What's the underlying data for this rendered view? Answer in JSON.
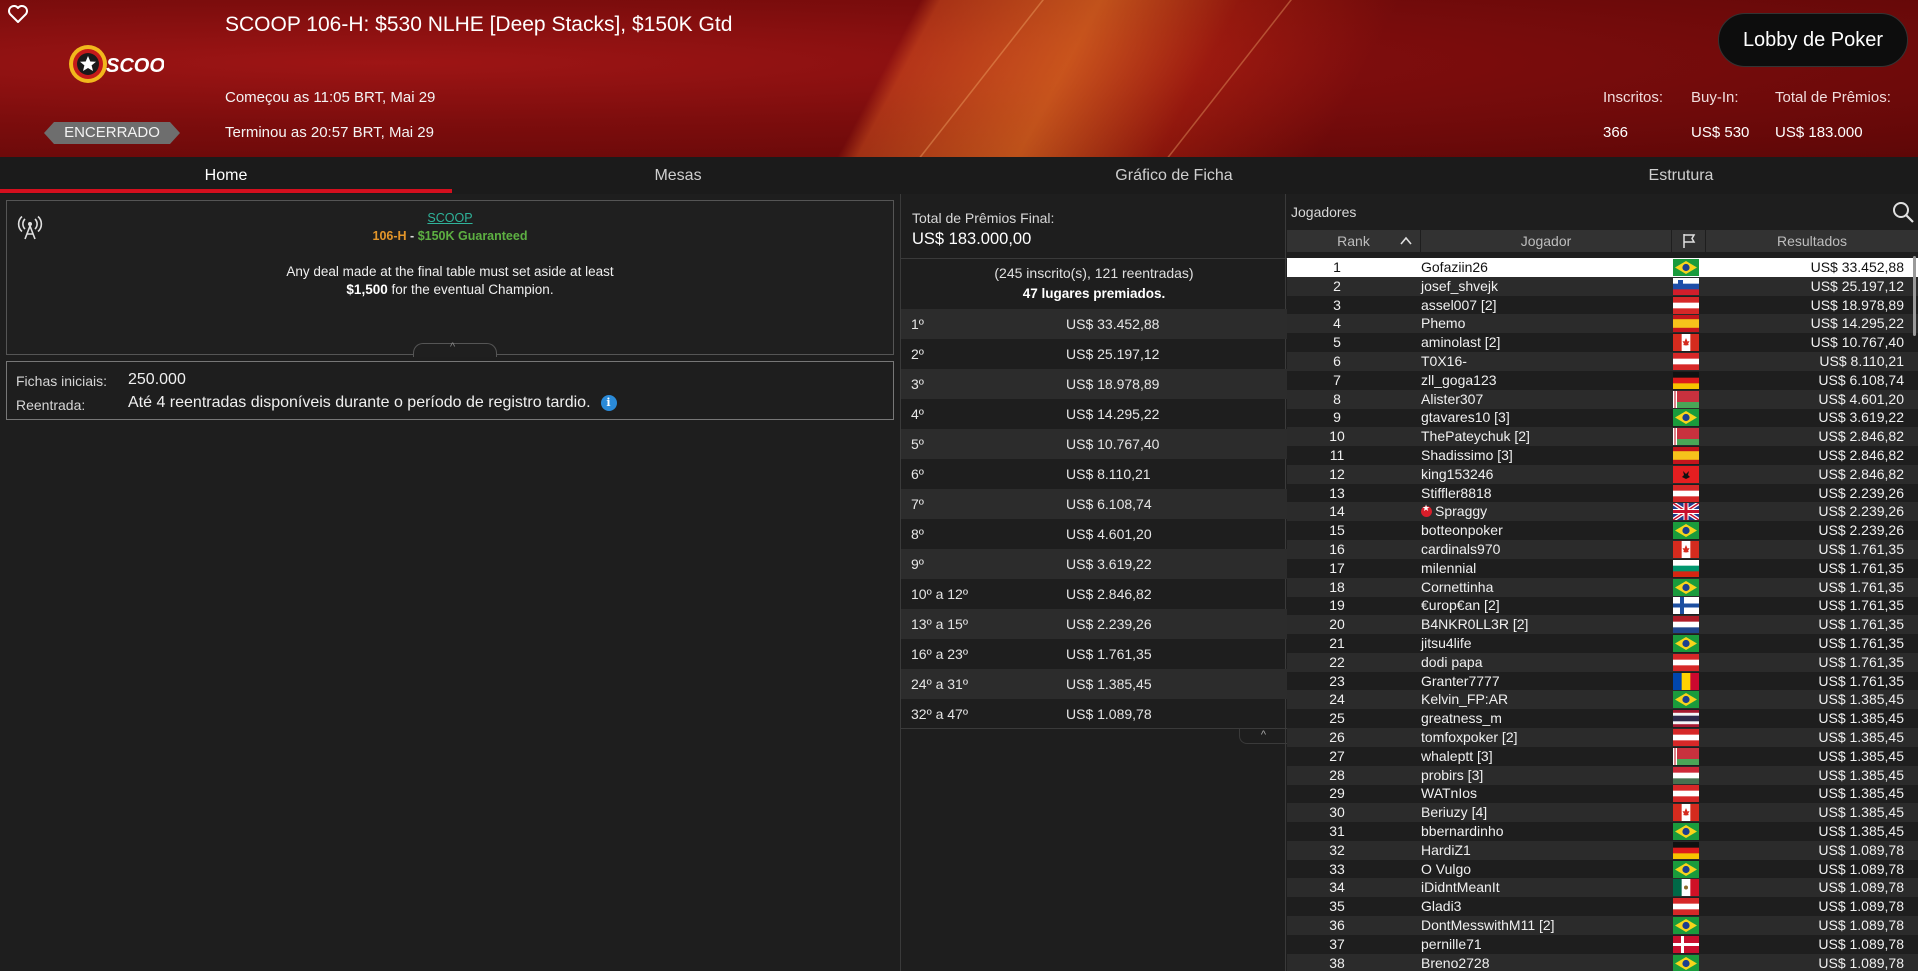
{
  "header": {
    "title": "SCOOP 106-H: $530 NLHE [Deep Stacks], $150K Gtd",
    "started": "Começou as 11:05 BRT, Mai 29",
    "ended": "Terminou as 20:57 BRT, Mai 29",
    "status": "ENCERRADO",
    "lobby_button": "Lobby de Poker",
    "logo_text": "SCOOP",
    "stats": {
      "entrants_label": "Inscritos:",
      "entrants_value": "366",
      "buyin_label": "Buy-In:",
      "buyin_value": "US$ 530",
      "prize_label": "Total de Prêmios:",
      "prize_value": "US$ 183.000"
    },
    "brand_color": "#8b0f10"
  },
  "tabs": [
    {
      "label": "Home",
      "active": true
    },
    {
      "label": "Mesas",
      "active": false
    },
    {
      "label": "Gráfico de Ficha",
      "active": false
    },
    {
      "label": "Estrutura",
      "active": false
    }
  ],
  "info": {
    "series_link": "SCOOP",
    "event_code": "106-H",
    "separator": "-",
    "guarantee": "$150K Guaranteed",
    "deal_line1": "Any deal made at the final table must set aside at least",
    "deal_amount": "$1,500",
    "deal_line2_rest": " for the eventual Champion."
  },
  "chips": {
    "start_label": "Fichas iniciais:",
    "start_value": "250.000",
    "reentry_label": "Reentrada:",
    "reentry_value": "Até 4 reentradas disponíveis durante o período de registro tardio.",
    "info_glyph": "i"
  },
  "prizes": {
    "title": "Total de Prêmios Final:",
    "total": "US$ 183.000,00",
    "entrants_line": "(245 inscrito(s), 121 reentradas)",
    "paid_line": "47 lugares premiados.",
    "rows": [
      {
        "place": "1º",
        "amount": "US$ 33.452,88"
      },
      {
        "place": "2º",
        "amount": "US$ 25.197,12"
      },
      {
        "place": "3º",
        "amount": "US$ 18.978,89"
      },
      {
        "place": "4º",
        "amount": "US$ 14.295,22"
      },
      {
        "place": "5º",
        "amount": "US$ 10.767,40"
      },
      {
        "place": "6º",
        "amount": "US$ 8.110,21"
      },
      {
        "place": "7º",
        "amount": "US$ 6.108,74"
      },
      {
        "place": "8º",
        "amount": "US$ 4.601,20"
      },
      {
        "place": "9º",
        "amount": "US$ 3.619,22"
      },
      {
        "place": "10º a 12º",
        "amount": "US$ 2.846,82"
      },
      {
        "place": "13º a 15º",
        "amount": "US$ 2.239,26"
      },
      {
        "place": "16º a 23º",
        "amount": "US$ 1.761,35"
      },
      {
        "place": "24º a 31º",
        "amount": "US$ 1.385,45"
      },
      {
        "place": "32º a 47º",
        "amount": "US$ 1.089,78"
      }
    ]
  },
  "players": {
    "title": "Jogadores",
    "col_rank": "Rank",
    "col_player": "Jogador",
    "col_results": "Resultados",
    "rows": [
      {
        "rank": "1",
        "name": "Gofaziin26",
        "flag": "br",
        "result": "US$ 33.452,88"
      },
      {
        "rank": "2",
        "name": "josef_shvejk",
        "flag": "si",
        "result": "US$ 25.197,12"
      },
      {
        "rank": "3",
        "name": "assel007 [2]",
        "flag": "at",
        "result": "US$ 18.978,89"
      },
      {
        "rank": "4",
        "name": "Phemo",
        "flag": "es",
        "result": "US$ 14.295,22"
      },
      {
        "rank": "5",
        "name": "aminolast [2]",
        "flag": "ca",
        "result": "US$ 10.767,40"
      },
      {
        "rank": "6",
        "name": "T0X16-",
        "flag": "at",
        "result": "US$ 8.110,21"
      },
      {
        "rank": "7",
        "name": "zll_goga123",
        "flag": "de",
        "result": "US$ 6.108,74"
      },
      {
        "rank": "8",
        "name": "Alister307",
        "flag": "by",
        "result": "US$ 4.601,20"
      },
      {
        "rank": "9",
        "name": "gtavares10 [3]",
        "flag": "br",
        "result": "US$ 3.619,22"
      },
      {
        "rank": "10",
        "name": "ThePateychuk [2]",
        "flag": "by",
        "result": "US$ 2.846,82"
      },
      {
        "rank": "11",
        "name": "Shadissimo [3]",
        "flag": "es",
        "result": "US$ 2.846,82"
      },
      {
        "rank": "12",
        "name": "king153246",
        "flag": "al",
        "result": "US$ 2.846,82"
      },
      {
        "rank": "13",
        "name": "Stiffler8818",
        "flag": "at",
        "result": "US$ 2.239,26"
      },
      {
        "rank": "14",
        "name": "Spraggy",
        "flag": "gb",
        "result": "US$ 2.239,26",
        "pro": true
      },
      {
        "rank": "15",
        "name": "botteonpoker",
        "flag": "br",
        "result": "US$ 2.239,26"
      },
      {
        "rank": "16",
        "name": "cardinals970",
        "flag": "ca",
        "result": "US$ 1.761,35"
      },
      {
        "rank": "17",
        "name": "milennial",
        "flag": "bg",
        "result": "US$ 1.761,35"
      },
      {
        "rank": "18",
        "name": "Cornettinha",
        "flag": "br",
        "result": "US$ 1.761,35"
      },
      {
        "rank": "19",
        "name": "€urop€an [2]",
        "flag": "fi",
        "result": "US$ 1.761,35"
      },
      {
        "rank": "20",
        "name": "B4NKR0LL3R [2]",
        "flag": "nl",
        "result": "US$ 1.761,35"
      },
      {
        "rank": "21",
        "name": "jitsu4life",
        "flag": "br",
        "result": "US$ 1.761,35"
      },
      {
        "rank": "22",
        "name": "dodi papa",
        "flag": "at",
        "result": "US$ 1.761,35"
      },
      {
        "rank": "23",
        "name": "Granter7777",
        "flag": "md",
        "result": "US$ 1.761,35"
      },
      {
        "rank": "24",
        "name": "Kelvin_FP:AR",
        "flag": "br",
        "result": "US$ 1.385,45"
      },
      {
        "rank": "25",
        "name": "greatness_m",
        "flag": "th",
        "result": "US$ 1.385,45"
      },
      {
        "rank": "26",
        "name": "tomfoxpoker [2]",
        "flag": "at",
        "result": "US$ 1.385,45"
      },
      {
        "rank": "27",
        "name": "whaleptt [3]",
        "flag": "by",
        "result": "US$ 1.385,45"
      },
      {
        "rank": "28",
        "name": "probirs [3]",
        "flag": "hu",
        "result": "US$ 1.385,45"
      },
      {
        "rank": "29",
        "name": "WATnIos",
        "flag": "at",
        "result": "US$ 1.385,45"
      },
      {
        "rank": "30",
        "name": "Beriuzy [4]",
        "flag": "ca",
        "result": "US$ 1.385,45"
      },
      {
        "rank": "31",
        "name": "bbernardinho",
        "flag": "br",
        "result": "US$ 1.385,45"
      },
      {
        "rank": "32",
        "name": "HardiZ1",
        "flag": "de",
        "result": "US$ 1.089,78"
      },
      {
        "rank": "33",
        "name": "O Vulgo",
        "flag": "br",
        "result": "US$ 1.089,78"
      },
      {
        "rank": "34",
        "name": "iDidntMeanIt",
        "flag": "mx",
        "result": "US$ 1.089,78"
      },
      {
        "rank": "35",
        "name": "Gladi3",
        "flag": "at",
        "result": "US$ 1.089,78"
      },
      {
        "rank": "36",
        "name": "DontMesswithM11 [2]",
        "flag": "br",
        "result": "US$ 1.089,78"
      },
      {
        "rank": "37",
        "name": "pernille71",
        "flag": "dk",
        "result": "US$ 1.089,78"
      },
      {
        "rank": "38",
        "name": "Breno2728",
        "flag": "br",
        "result": "US$ 1.089,78"
      }
    ]
  }
}
